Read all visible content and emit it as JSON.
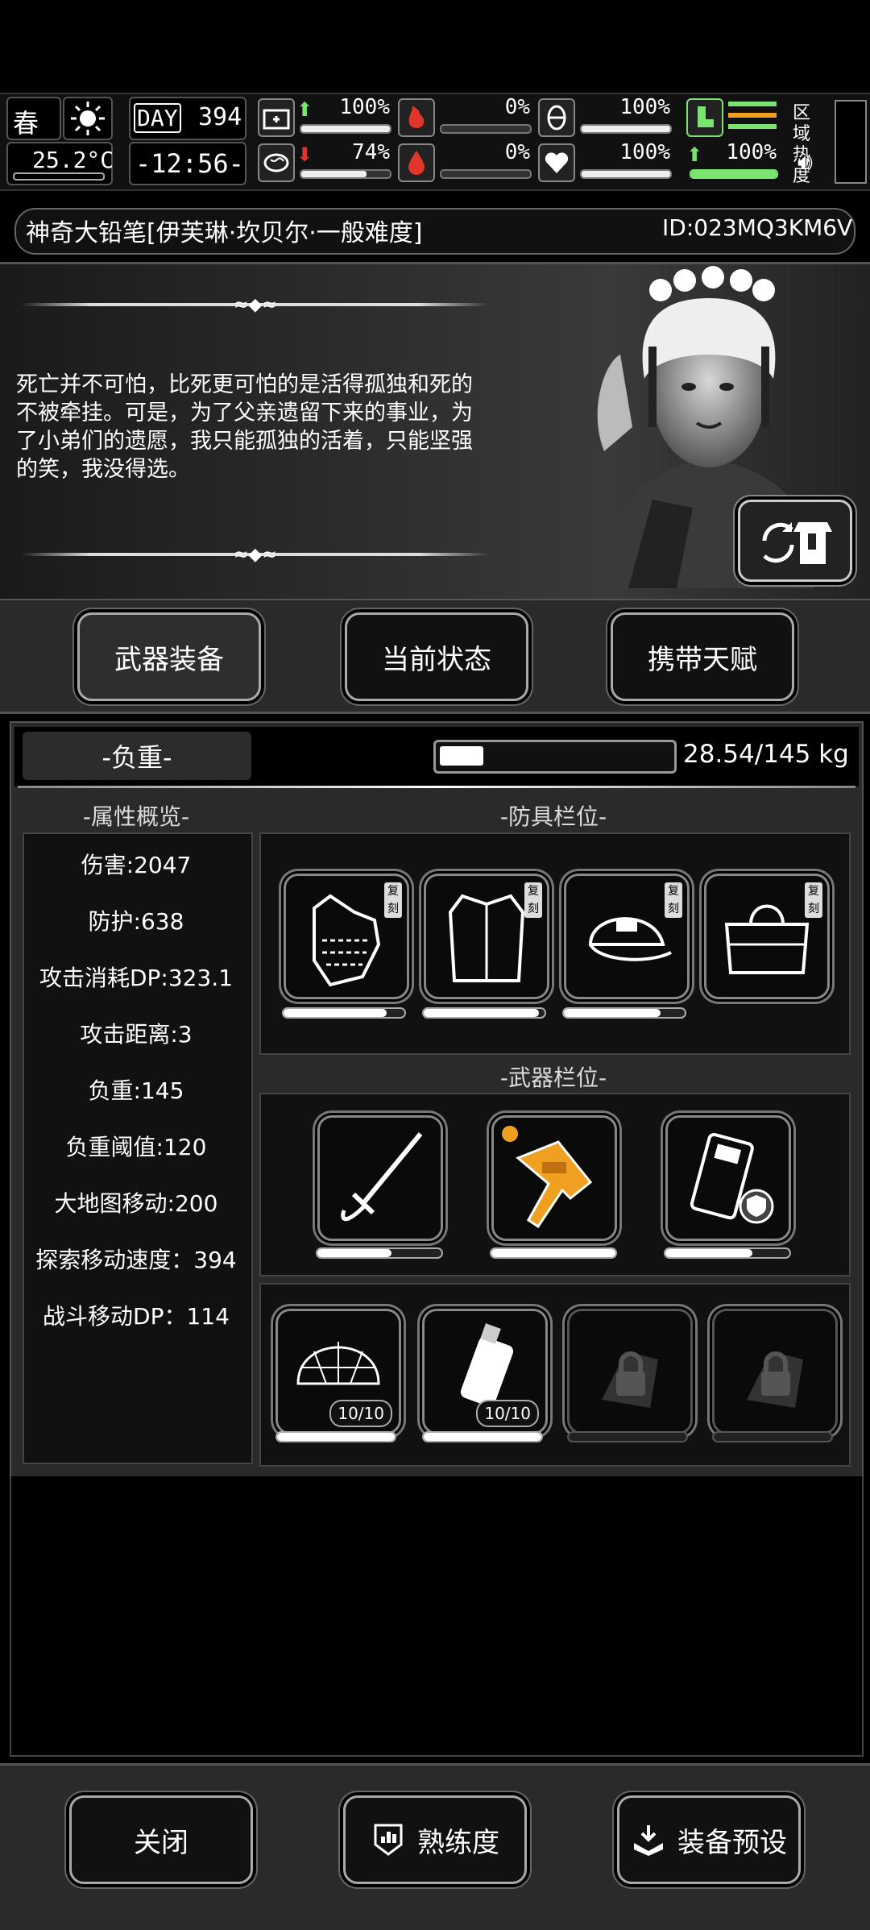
{
  "status": {
    "season": "春",
    "temperature": "25.2°C",
    "day_label": "DAY",
    "day": "394",
    "time": "-12:56-",
    "medical_pct": "100%",
    "hunger_pct": "0%",
    "stamina_pct": "100%",
    "mood_pct": "74%",
    "thirst_pct": "0%",
    "health_pct": "100%",
    "move_pct": "100%",
    "region_heat": "区域热度"
  },
  "character": {
    "name_line": "神奇大铅笔[伊芙琳·坎贝尔·一般难度]",
    "id": "ID:023MQ3KM6V",
    "quote": "死亡并不可怕，比死更可怕的是活得孤独和死的不被牵挂。可是，为了父亲遗留下来的事业，为了小弟们的遗愿，我只能孤独的活着，只能坚强的笑，我没得选。"
  },
  "tabs": [
    "武器装备",
    "当前状态",
    "携带天赋"
  ],
  "load": {
    "label": "-负重-",
    "value": "28.54/145 kg",
    "fraction": 0.197
  },
  "sections": {
    "attributes": "-属性概览-",
    "armor": "-防具栏位-",
    "weapons": "-武器栏位-"
  },
  "attributes": [
    "伤害:2047",
    "防护:638",
    "攻击消耗DP:323.1",
    "攻击距离:3",
    "负重:145",
    "负重阈值:120",
    "大地图移动:200",
    "探索移动速度：394",
    "战斗移动DP：114"
  ],
  "armor_slots": [
    {
      "icon": "gloves-icon",
      "badge": "复刻",
      "durability": 0.85
    },
    {
      "icon": "coat-icon",
      "badge": "复刻",
      "durability": 0.95
    },
    {
      "icon": "cap-icon",
      "badge": "复刻",
      "durability": 0.8
    },
    {
      "icon": "bag-icon",
      "badge": "复刻"
    }
  ],
  "weapon_slots": [
    {
      "icon": "sword-icon",
      "durability": 0.6
    },
    {
      "icon": "rifle-icon",
      "durability": 1.0
    },
    {
      "icon": "shield-device-icon",
      "durability": 0.7
    }
  ],
  "tool_slots": [
    {
      "icon": "net-icon",
      "count": "10/10",
      "durability": 1.0
    },
    {
      "icon": "grenade-icon",
      "count": "10/10",
      "durability": 1.0
    },
    {
      "icon": "lock-icon"
    },
    {
      "icon": "lock-icon"
    }
  ],
  "bottom": {
    "close": "关闭",
    "proficiency": "熟练度",
    "preset": "装备预设"
  },
  "colors": {
    "accent": "#ffffff",
    "green": "#7be36f",
    "red": "#e0352b",
    "orange": "#f0a020"
  }
}
